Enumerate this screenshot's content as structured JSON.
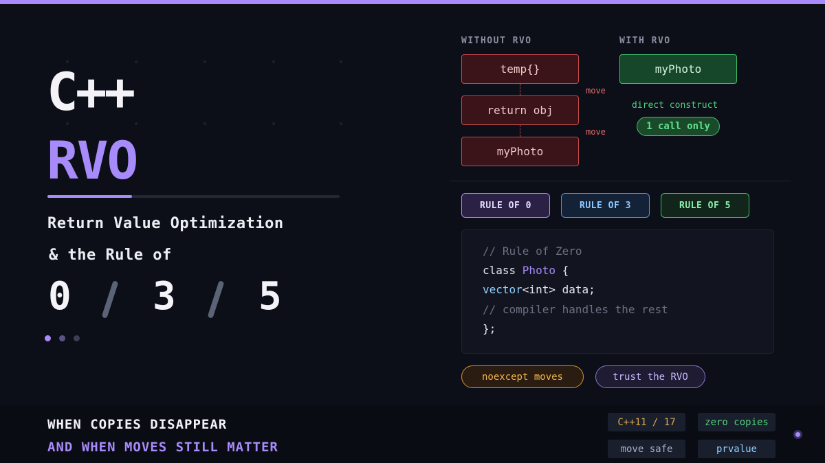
{
  "colors": {
    "accent": "#a78bfa",
    "background": "#0d0f18",
    "danger": "#c24a4a",
    "success": "#3fbf6a",
    "info": "#5a8fe6",
    "warning": "#d9922e"
  },
  "hero": {
    "title_line1": "C++",
    "title_line2": "RVO",
    "subtitle_line1": "Return Value Optimization",
    "subtitle_line2": "& the Rule of",
    "rules": [
      "0",
      "3",
      "5"
    ],
    "progress": 0.29,
    "pager_active_index": 0,
    "pager_count": 3
  },
  "diagram": {
    "without_label": "WITHOUT RVO",
    "with_label": "WITH RVO",
    "without_steps": [
      "temp{}",
      "return obj",
      "myPhoto"
    ],
    "move_label": "move",
    "with_box": "myPhoto",
    "direct_label": "direct construct",
    "calls_badge": "1 call only"
  },
  "tabs": [
    "RULE OF 0",
    "RULE OF 3",
    "RULE OF 5"
  ],
  "code": {
    "comment1": "// Rule of Zero",
    "class_kw": "class ",
    "class_name": "Photo",
    "brace_open": " {",
    "member_type": "vector",
    "member_rest": "<int> data;",
    "comment2": "// compiler handles the rest",
    "brace_close": "};"
  },
  "chips": [
    "noexcept moves",
    "trust the RVO"
  ],
  "footer": {
    "line1": "WHEN COPIES DISAPPEAR",
    "line2": "AND WHEN MOVES STILL MATTER",
    "tags": [
      "C++11 / 17",
      "zero copies",
      "move safe",
      "prvalue"
    ]
  }
}
